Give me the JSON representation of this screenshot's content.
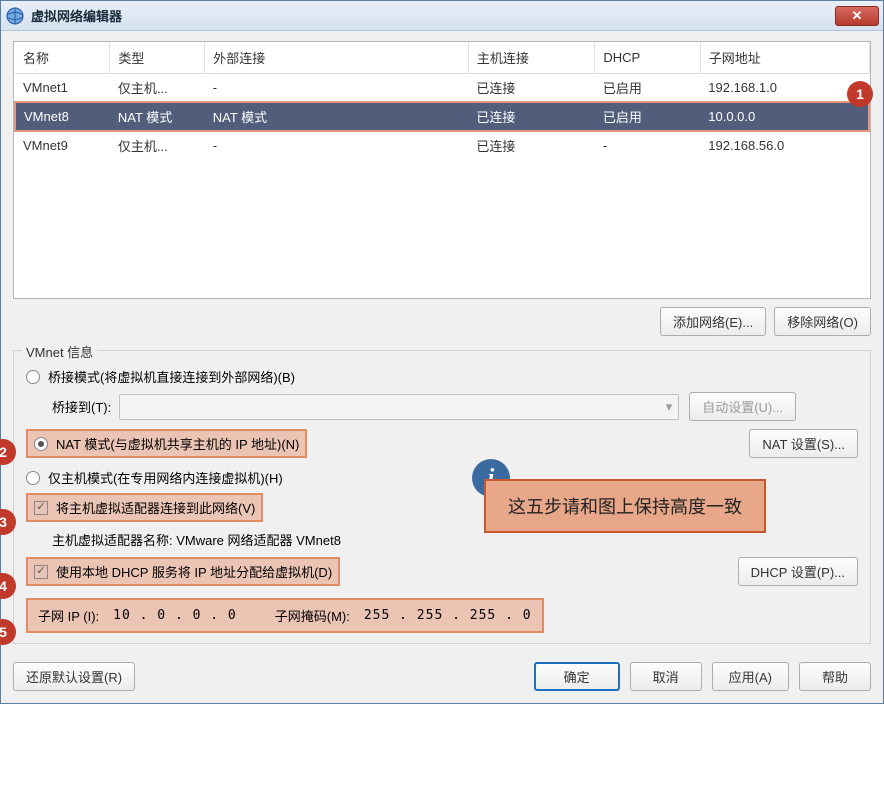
{
  "titlebar": {
    "title": "虚拟网络编辑器",
    "close_icon": "✕"
  },
  "table": {
    "headers": [
      "名称",
      "类型",
      "外部连接",
      "主机连接",
      "DHCP",
      "子网地址"
    ],
    "rows": [
      {
        "name": "VMnet1",
        "type": "仅主机...",
        "ext": "-",
        "host": "已连接",
        "dhcp": "已启用",
        "subnet": "192.168.1.0",
        "sel": false
      },
      {
        "name": "VMnet8",
        "type": "NAT 模式",
        "ext": "NAT 模式",
        "host": "已连接",
        "dhcp": "已启用",
        "subnet": "10.0.0.0",
        "sel": true
      },
      {
        "name": "VMnet9",
        "type": "仅主机...",
        "ext": "-",
        "host": "已连接",
        "dhcp": "-",
        "subnet": "192.168.56.0",
        "sel": false
      }
    ]
  },
  "buttons": {
    "add_network": "添加网络(E)...",
    "remove_network": "移除网络(O)",
    "auto_settings": "自动设置(U)...",
    "nat_settings": "NAT 设置(S)...",
    "dhcp_settings": "DHCP 设置(P)...",
    "restore_default": "还原默认设置(R)",
    "ok": "确定",
    "cancel": "取消",
    "apply": "应用(A)",
    "help": "帮助"
  },
  "fieldset": {
    "legend": "VMnet 信息",
    "bridge_radio": "桥接模式(将虚拟机直接连接到外部网络)(B)",
    "bridge_to_label": "桥接到(T):",
    "nat_radio": "NAT 模式(与虚拟机共享主机的 IP 地址)(N)",
    "host_only_radio": "仅主机模式(在专用网络内连接虚拟机)(H)",
    "connect_host_check": "将主机虚拟适配器连接到此网络(V)",
    "adapter_name_label": "主机虚拟适配器名称: VMware 网络适配器 VMnet8",
    "use_dhcp_check": "使用本地 DHCP 服务将 IP 地址分配给虚拟机(D)",
    "subnet_ip_label": "子网 IP (I):",
    "subnet_ip_value": "10  .  0  .  0  .  0",
    "subnet_mask_label": "子网掩码(M):",
    "subnet_mask_value": "255 . 255 . 255 .  0"
  },
  "markers": {
    "m1": "1",
    "m2": "2",
    "m3": "3",
    "m4": "4",
    "m5": "5"
  },
  "callout": {
    "info_icon": "i",
    "text": "这五步请和图上保持高度一致"
  },
  "dropdown_arrow": "▾"
}
